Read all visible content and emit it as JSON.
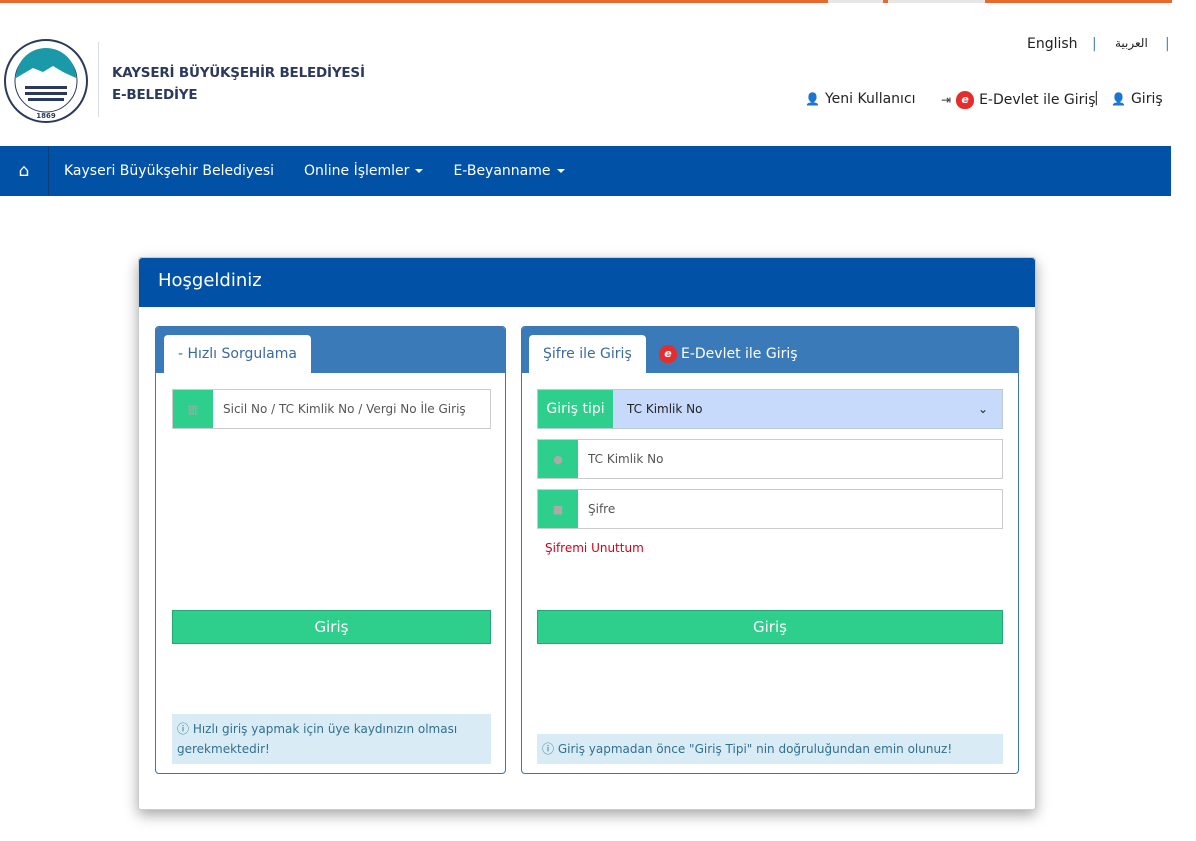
{
  "header": {
    "brand_line1": "KAYSERİ BÜYÜKŞEHİR BELEDİYESİ",
    "brand_line2": "E-BELEDİYE",
    "logo_text": "KAYSERİ BÜYÜKŞEHİR BELEDİYESİ 1869",
    "lang_english": "English",
    "lang_arabic": "العربية",
    "new_user": "Yeni Kullanıcı",
    "edevlet_login": "E-Devlet ile Giriş",
    "login": "Giriş"
  },
  "nav": {
    "items": [
      {
        "label": "Kayseri Büyükşehir Belediyesi"
      },
      {
        "label": "Online İşlemler"
      },
      {
        "label": "E-Beyanname"
      }
    ]
  },
  "card": {
    "title": "Hoşgeldiniz",
    "left": {
      "tab": "- Hızlı Sorgulama",
      "placeholder": "Sicil No / TC Kimlik No / Vergi No İle Giriş",
      "button": "Giriş",
      "info": "Hızlı giriş yapmak için üye kaydınızın olması gerekmektedir!"
    },
    "right": {
      "tab_active": "Şifre ile Giriş",
      "tab_edevlet": "E-Devlet ile Giriş",
      "type_label": "Giriş tipi",
      "type_value": "TC Kimlik No",
      "tc_placeholder": "TC Kimlik No",
      "password_placeholder": "Şifre",
      "forgot": "Şifremi Unuttum",
      "button": "Giriş",
      "info": "Giriş yapmadan önce \"Giriş Tipi\" nin doğruluğundan emin olunuz!"
    }
  },
  "colors": {
    "primary": "#0152a7",
    "accent": "#e8692d",
    "success": "#2ecf8c",
    "panel_header": "#3a7ab8"
  }
}
